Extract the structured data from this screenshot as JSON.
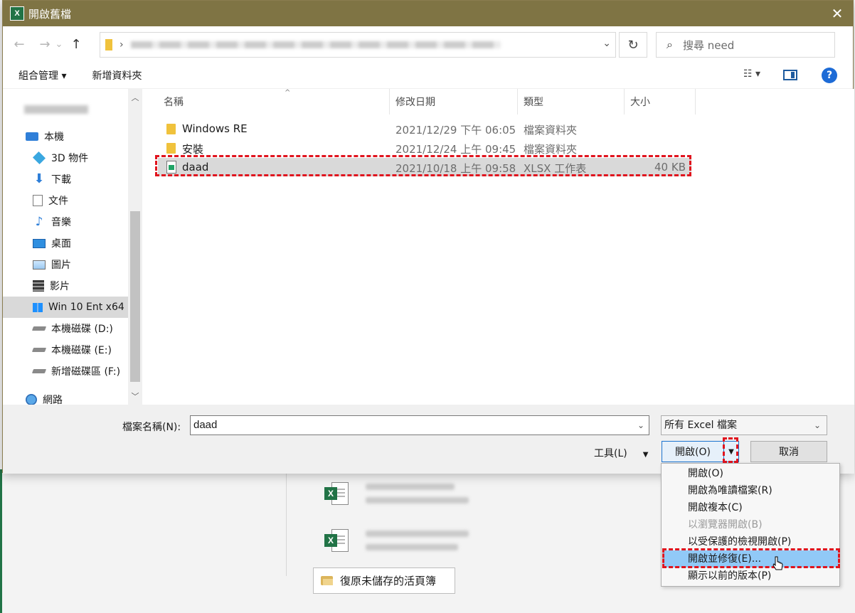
{
  "dialog": {
    "title": "開啟舊檔",
    "close_glyph": "✕",
    "app_badge": "X"
  },
  "nav": {
    "back": "←",
    "forward": "→",
    "recent": "⌄",
    "up": "↑",
    "address_separator": "›",
    "address_dropdown": "⌄",
    "refresh": "↻",
    "search_placeholder": "搜尋 need"
  },
  "toolbar": {
    "organize": "組合管理 ▾",
    "new_folder": "新增資料夾",
    "view_glyph": "☷ ▾",
    "help": "?"
  },
  "sidebar": {
    "items": [
      {
        "label": "本機"
      },
      {
        "label": "3D 物件"
      },
      {
        "label": "下載"
      },
      {
        "label": "文件"
      },
      {
        "label": "音樂"
      },
      {
        "label": "桌面"
      },
      {
        "label": "圖片"
      },
      {
        "label": "影片"
      },
      {
        "label": "Win 10 Ent x64"
      },
      {
        "label": "本機磁碟 (D:)"
      },
      {
        "label": "本機磁碟 (E:)"
      },
      {
        "label": "新增磁碟區 (F:)"
      },
      {
        "label": "網路"
      }
    ],
    "scroll_up": "︿",
    "scroll_down": "﹀"
  },
  "filelist": {
    "columns": {
      "name": "名稱",
      "date": "修改日期",
      "type": "類型",
      "size": "大小"
    },
    "sort_arrow": "^",
    "rows": [
      {
        "name": "Windows RE",
        "date": "2021/12/29 下午 06:05",
        "type": "檔案資料夾",
        "size": ""
      },
      {
        "name": "安裝",
        "date": "2021/12/24 上午 09:45",
        "type": "檔案資料夾",
        "size": ""
      },
      {
        "name": "daad",
        "date": "2021/10/18 上午 09:58",
        "type": "XLSX 工作表",
        "size": "40 KB"
      }
    ]
  },
  "bottom": {
    "filename_label": "檔案名稱(N):",
    "filename_value": "daad",
    "filter_value": "所有 Excel 檔案",
    "tools": "工具(L)",
    "open": "開啟(O)",
    "cancel": "取消",
    "dd_glyph": "⌄",
    "tri": "▼"
  },
  "menu": {
    "items": [
      {
        "label": "開啟(O)"
      },
      {
        "label": "開啟為唯讀檔案(R)"
      },
      {
        "label": "開啟複本(C)"
      },
      {
        "label": "以瀏覽器開啟(B)"
      },
      {
        "label": "以受保護的檢視開啟(P)"
      },
      {
        "label": "開啟並修復(E)..."
      },
      {
        "label": "顯示以前的版本(P)"
      }
    ]
  },
  "backstage": {
    "recover_button": "復原未儲存的活頁簿",
    "badge": "X"
  },
  "colors": {
    "titlebar": "#7f7444",
    "excel_green": "#217346",
    "highlight_red": "#e0141e",
    "menu_hover": "#91c9f7"
  }
}
